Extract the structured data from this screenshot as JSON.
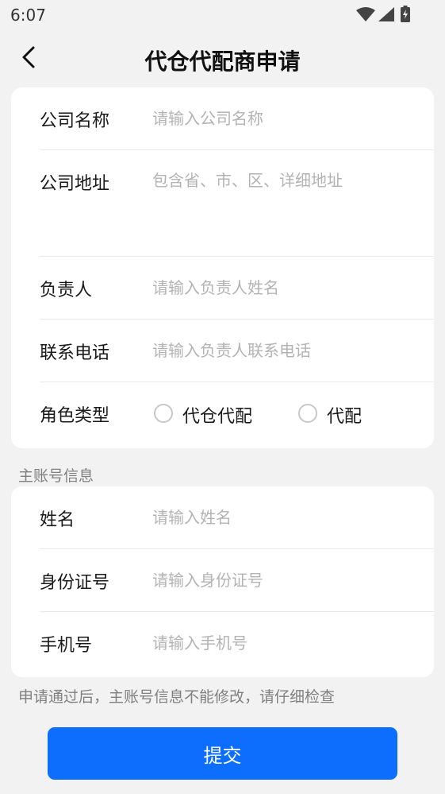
{
  "status_bar": {
    "time": "6:07",
    "icons": [
      "wifi-icon",
      "cell-signal-icon",
      "battery-charging-icon"
    ]
  },
  "header": {
    "title": "代仓代配商申请",
    "back_icon": "chevron-left-icon"
  },
  "company_card": {
    "company_name": {
      "label": "公司名称",
      "placeholder": "请输入公司名称",
      "value": ""
    },
    "company_address": {
      "label": "公司地址",
      "placeholder": "包含省、市、区、详细地址",
      "value": ""
    },
    "person_in_charge": {
      "label": "负责人",
      "placeholder": "请输入负责人姓名",
      "value": ""
    },
    "contact_phone": {
      "label": "联系电话",
      "placeholder": "请输入负责人联系电话",
      "value": ""
    },
    "role_type": {
      "label": "角色类型",
      "options": [
        {
          "label": "代仓代配",
          "selected": false
        },
        {
          "label": "代配",
          "selected": false
        }
      ]
    }
  },
  "main_account": {
    "section_title": "主账号信息",
    "name": {
      "label": "姓名",
      "placeholder": "请输入姓名",
      "value": ""
    },
    "id_number": {
      "label": "身份证号",
      "placeholder": "请输入身份证号",
      "value": ""
    },
    "mobile": {
      "label": "手机号",
      "placeholder": "请输入手机号",
      "value": ""
    }
  },
  "footer": {
    "note": "申请通过后，主账号信息不能修改，请仔细检查",
    "submit_label": "提交"
  },
  "colors": {
    "background": "#f2f2f2",
    "card": "#ffffff",
    "primary": "#0d6efd",
    "placeholder": "#b3b3b3",
    "caption": "#808080"
  }
}
